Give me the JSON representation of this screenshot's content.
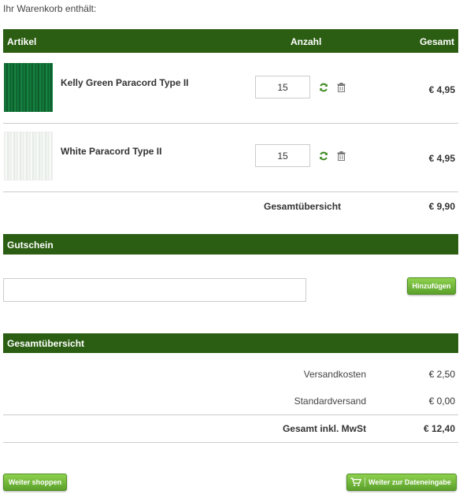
{
  "intro": "Ihr Warenkorb enthält:",
  "table_header": {
    "col_article": "Artikel",
    "col_qty": "Anzahl",
    "col_total": "Gesamt"
  },
  "items": [
    {
      "name": "Kelly Green Paracord Type II",
      "qty": "15",
      "price": "€ 4,95",
      "thumb_color": "#138a3a"
    },
    {
      "name": "White Paracord Type II",
      "qty": "15",
      "price": "€ 4,95",
      "thumb_color": "#f2f4f2"
    }
  ],
  "subtotal": {
    "label": "Gesamtübersicht",
    "value": "€ 9,90"
  },
  "coupon": {
    "header": "Gutschein",
    "input_value": "",
    "button": "Hinzufügen"
  },
  "summary": {
    "header": "Gesamtübersicht",
    "rows": [
      {
        "label": "Versandkosten",
        "value": "€ 2,50"
      },
      {
        "label": "Standardversand",
        "value": "€ 0,00"
      }
    ],
    "total_label": "Gesamt inkl. MwSt",
    "total_value": "€ 12,40"
  },
  "buttons": {
    "continue_shopping": "Weiter shoppen",
    "checkout": "Weiter zur Dateneingabe"
  },
  "colors": {
    "header_bg": "#2b5e12",
    "button_green": "#6fb63a",
    "icon_green": "#3d8a1e"
  }
}
